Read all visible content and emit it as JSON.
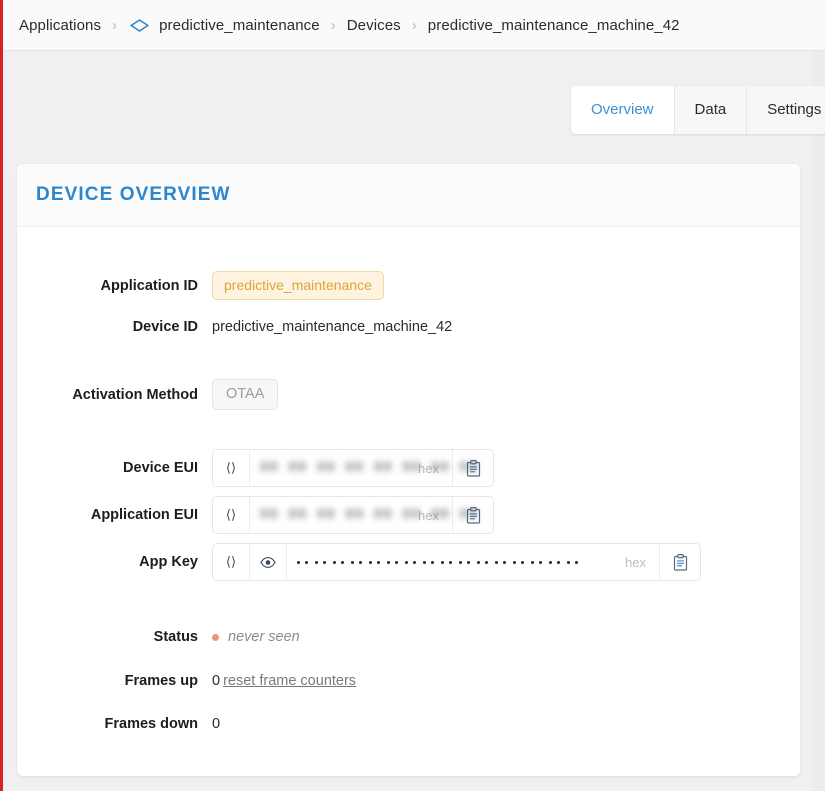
{
  "breadcrumb": {
    "items": [
      {
        "label": "Applications",
        "icon": null
      },
      {
        "label": "predictive_maintenance",
        "icon": "diamond-icon"
      },
      {
        "label": "Devices",
        "icon": null
      },
      {
        "label": "predictive_maintenance_machine_42",
        "icon": null
      }
    ],
    "separator": "›"
  },
  "tabs": [
    {
      "label": "Overview",
      "active": true
    },
    {
      "label": "Data",
      "active": false
    },
    {
      "label": "Settings",
      "active": false
    }
  ],
  "card": {
    "title": "DEVICE OVERVIEW",
    "fields": {
      "application_id_label": "Application ID",
      "application_id_value": "predictive_maintenance",
      "device_id_label": "Device ID",
      "device_id_value": "predictive_maintenance_machine_42",
      "activation_method_label": "Activation Method",
      "activation_method_value": "OTAA",
      "device_eui_label": "Device EUI",
      "device_eui_value": "00 00 00 00 00 00 00 00",
      "application_eui_label": "Application EUI",
      "application_eui_value": "00 00 00 00 00 00 00 00",
      "app_key_label": "App Key",
      "app_key_value": "",
      "hex_label": "hex",
      "status_label": "Status",
      "status_value": "never seen",
      "frames_up_label": "Frames up",
      "frames_up_value": "0",
      "reset_link": "reset frame counters",
      "frames_down_label": "Frames down",
      "frames_down_value": "0"
    }
  },
  "colors": {
    "accent_blue": "#2b86d0",
    "tab_active_text": "#3f8fd2",
    "badge_bg": "#fdf3df",
    "badge_border": "#f0d9a8",
    "badge_text": "#e0a33c",
    "status_dot": "#f0937c",
    "left_stripe": "#d6202c"
  }
}
